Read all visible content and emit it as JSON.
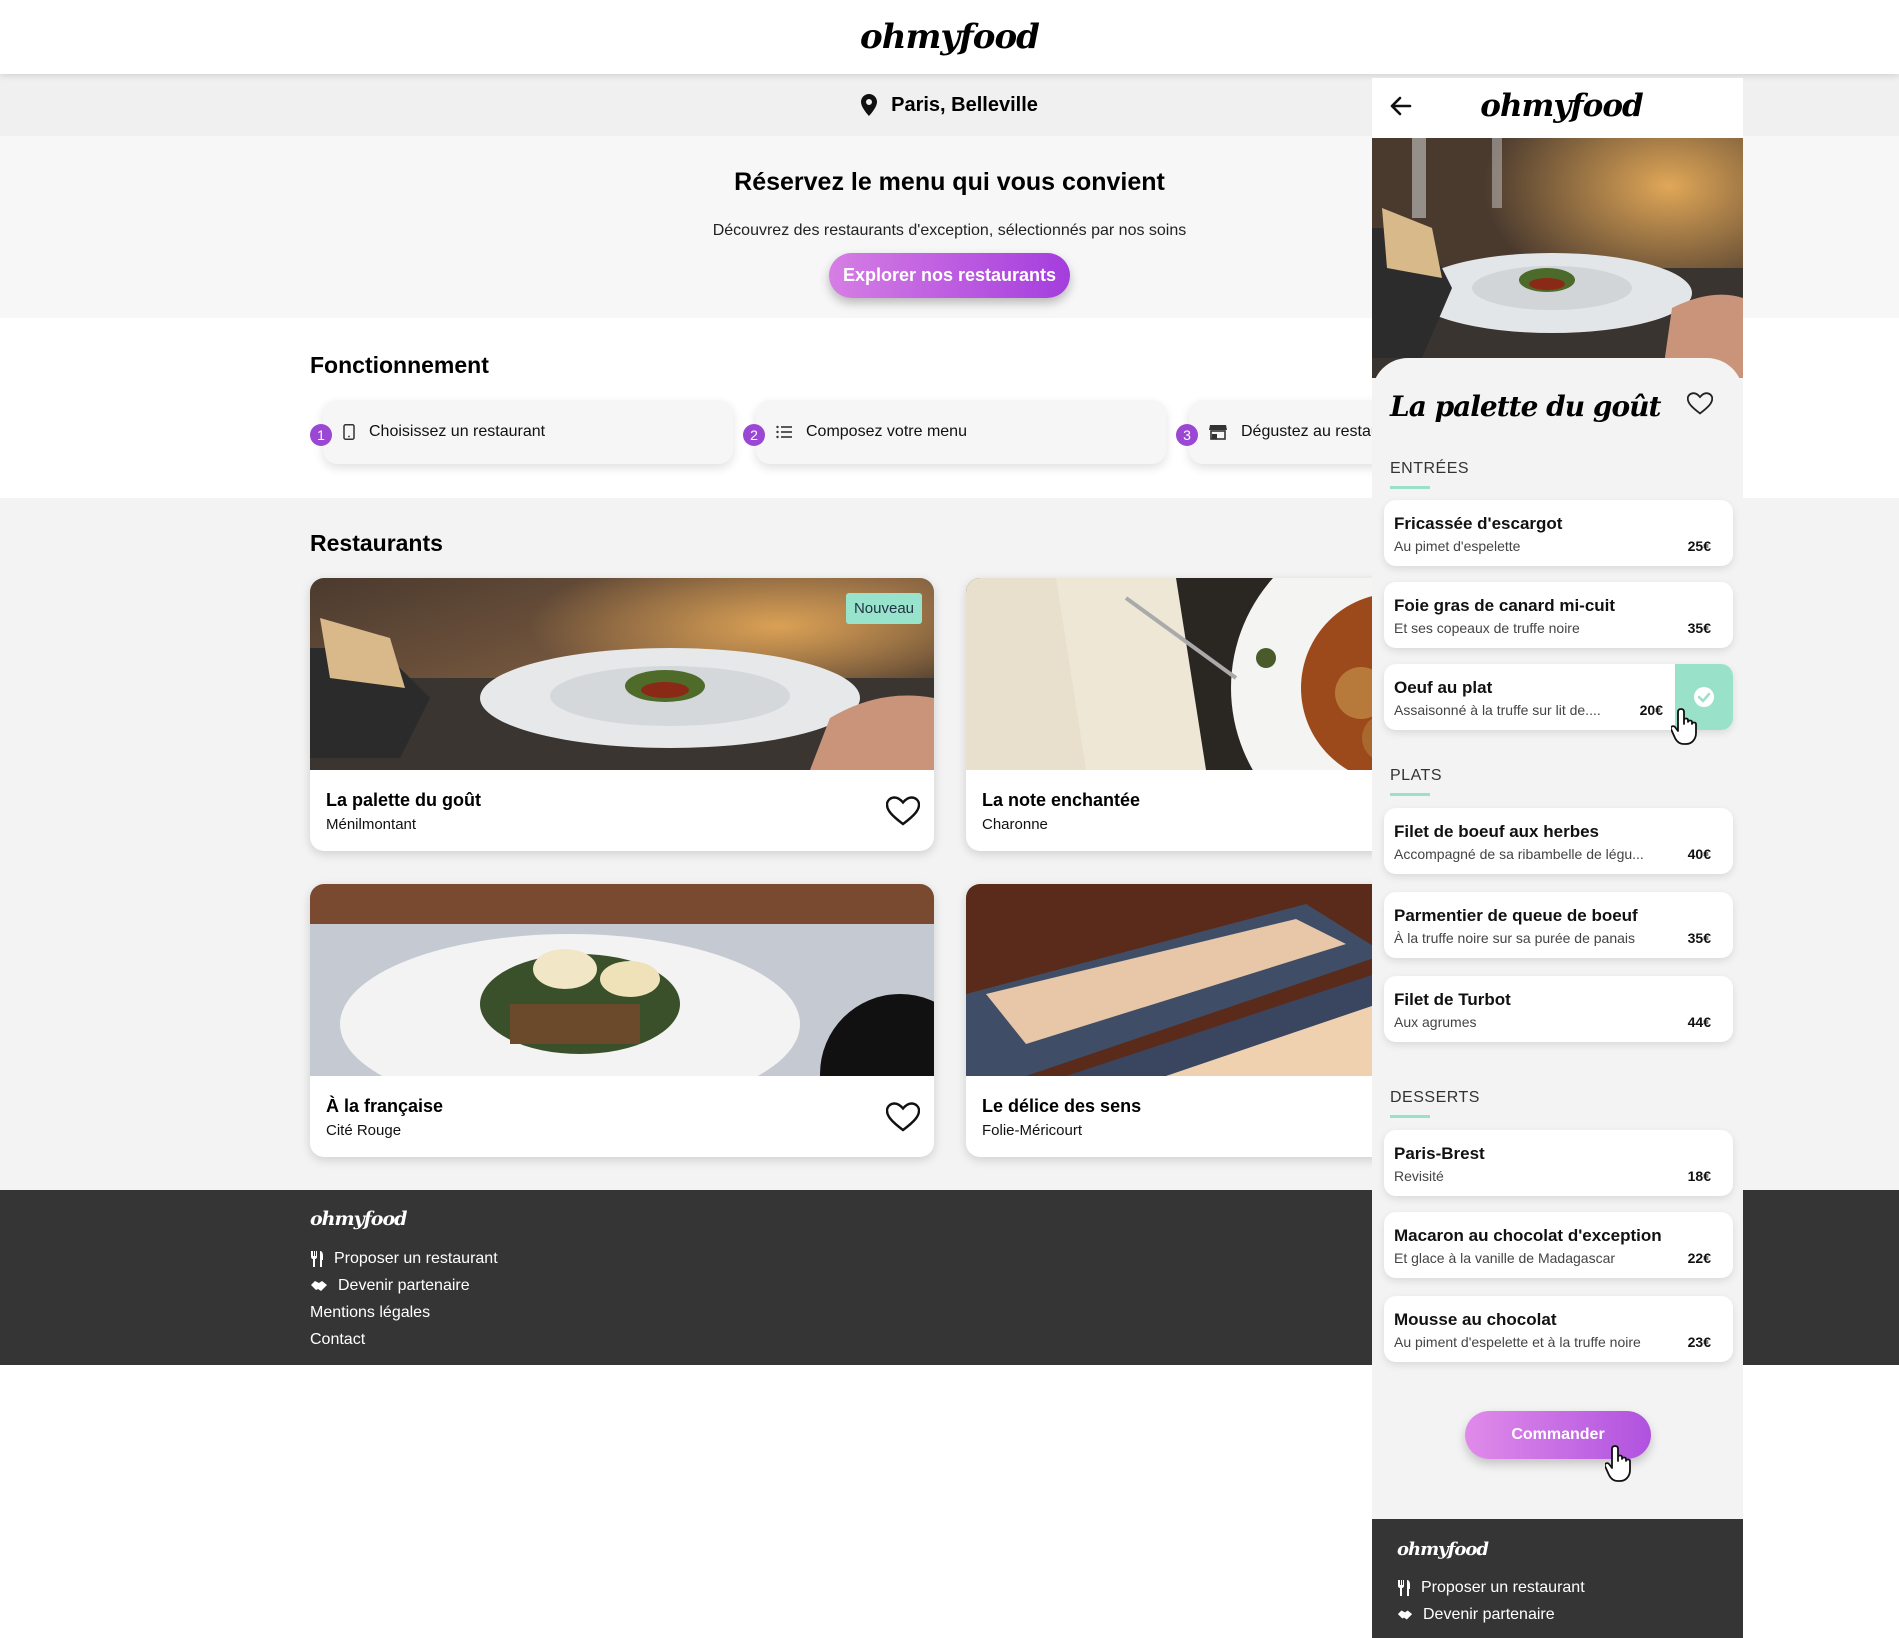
{
  "brand": "ohmyfood",
  "location": "Paris, Belleville",
  "hero": {
    "title": "Réservez le menu qui vous convient",
    "subtitle": "Découvrez des restaurants d'exception, sélectionnés par nos soins",
    "cta": "Explorer nos restaurants"
  },
  "how": {
    "title": "Fonctionnement",
    "steps": [
      {
        "num": "1",
        "label": "Choisissez un restaurant",
        "icon": "phone-icon"
      },
      {
        "num": "2",
        "label": "Composez votre menu",
        "icon": "list-icon"
      },
      {
        "num": "3",
        "label": "Dégustez au restaurant",
        "icon": "store-icon"
      }
    ]
  },
  "restaurants": {
    "title": "Restaurants",
    "badge": "Nouveau",
    "items": [
      {
        "name": "La palette du goût",
        "area": "Ménilmontant"
      },
      {
        "name": "La note enchantée",
        "area": "Charonne"
      },
      {
        "name": "À la française",
        "area": "Cité Rouge"
      },
      {
        "name": "Le délice des sens",
        "area": "Folie-Méricourt"
      }
    ]
  },
  "footer": {
    "links": [
      "Proposer un restaurant",
      "Devenir partenaire",
      "Mentions légales",
      "Contact"
    ]
  },
  "mobile": {
    "restaurant": "La palette du goût",
    "sections": [
      {
        "title": "ENTRÉES",
        "items": [
          {
            "name": "Fricassée d'escargot",
            "desc": "Au pimet d'espelette",
            "price": "25€"
          },
          {
            "name": "Foie gras de canard mi-cuit",
            "desc": "Et ses copeaux de truffe noire",
            "price": "35€"
          },
          {
            "name": "Oeuf au plat",
            "desc": "Assaisonné à la truffe sur lit de....",
            "price": "20€"
          }
        ]
      },
      {
        "title": "PLATS",
        "items": [
          {
            "name": "Filet de boeuf aux herbes",
            "desc": "Accompagné de sa ribambelle de légu...",
            "price": "40€"
          },
          {
            "name": "Parmentier de queue de boeuf",
            "desc": "À la truffe noire sur sa purée de panais",
            "price": "35€"
          },
          {
            "name": "Filet de Turbot",
            "desc": "Aux agrumes",
            "price": "44€"
          }
        ]
      },
      {
        "title": "DESSERTS",
        "items": [
          {
            "name": "Paris-Brest",
            "desc": "Revisité",
            "price": "18€"
          },
          {
            "name": "Macaron au chocolat d'exception",
            "desc": "Et glace à la vanille de Madagascar",
            "price": "22€"
          },
          {
            "name": "Mousse au chocolat",
            "desc": "Au piment d'espelette et à la truffe noire",
            "price": "23€"
          }
        ]
      }
    ],
    "order": "Commander",
    "footer_links": [
      "Proposer un restaurant",
      "Devenir partenaire"
    ]
  },
  "colors": {
    "accent_purple": "#9a48d4",
    "accent_green": "#99e2c9",
    "footer_bg": "#353535"
  }
}
